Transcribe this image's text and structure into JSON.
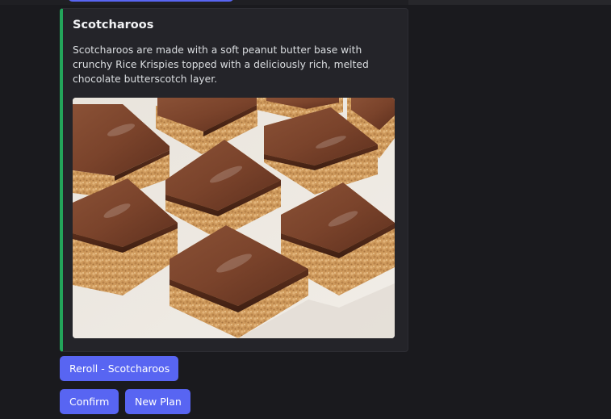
{
  "embed": {
    "accent_color": "#23a55a",
    "title": "Scotcharoos",
    "description": "Scotcharoos are made with a soft peanut butter base with crunchy Rice Krispies topped with a deliciously rich, melted chocolate butterscotch layer.",
    "image_subject": "scotcharoo-bars-photo"
  },
  "buttons": {
    "color": "#5865f2",
    "reroll_label": "Reroll - Scotcharoos",
    "confirm_label": "Confirm",
    "new_plan_label": "New Plan"
  }
}
